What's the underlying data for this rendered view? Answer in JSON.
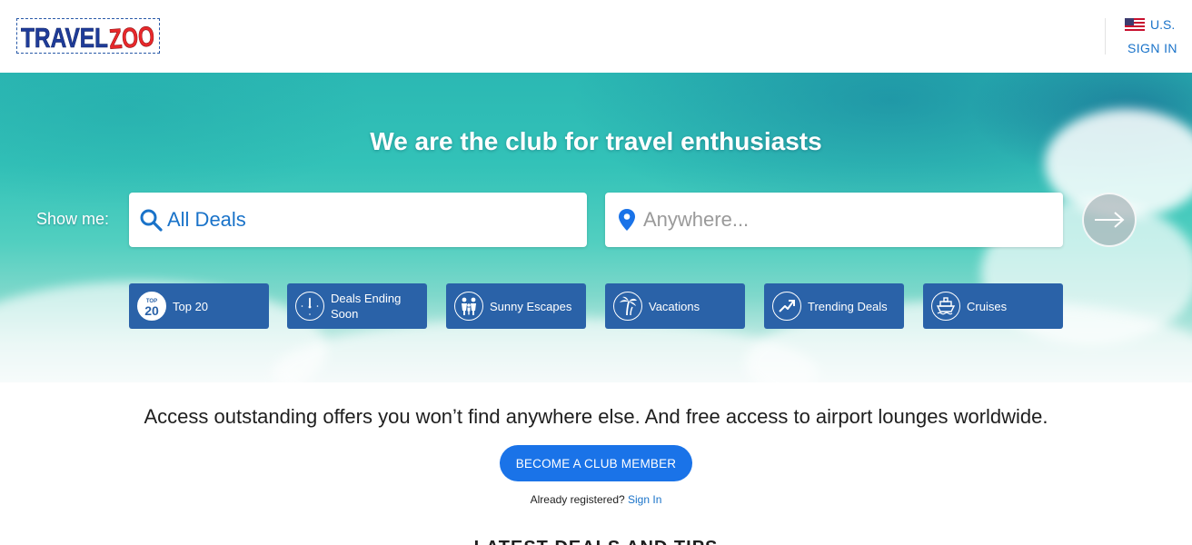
{
  "header": {
    "logo_text": "TRAVELZOO",
    "locale": "U.S.",
    "sign_in": "SIGN IN"
  },
  "hero": {
    "title": "We are the club for travel enthusiasts",
    "show_me_label": "Show me:",
    "deals_input_value": "All Deals",
    "location_placeholder": "Anywhere...",
    "categories": [
      {
        "label": "Top 20",
        "icon": "top-20-icon"
      },
      {
        "label": "Deals Ending Soon",
        "icon": "clock-icon"
      },
      {
        "label": "Sunny Escapes",
        "icon": "family-icon"
      },
      {
        "label": "Vacations",
        "icon": "palm-tree-icon"
      },
      {
        "label": "Trending Deals",
        "icon": "trending-icon"
      },
      {
        "label": "Cruises",
        "icon": "ship-icon"
      }
    ]
  },
  "membership": {
    "tagline": "Access outstanding offers you won’t find anywhere else. And free access to airport lounges worldwide.",
    "button": "BECOME A CLUB MEMBER",
    "already_text": "Already registered?",
    "sign_in_link": "Sign In"
  },
  "section": {
    "heading": "LATEST DEALS AND TIPS"
  },
  "colors": {
    "brand_blue": "#1a73e8",
    "category_bg": "#2a62a8",
    "link": "#1a73c9"
  }
}
